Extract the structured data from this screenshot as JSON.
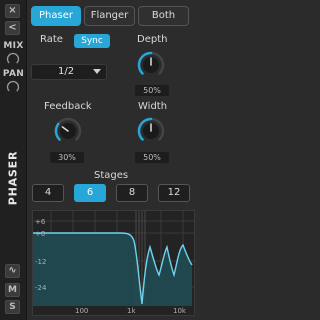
{
  "sidebar": {
    "close_glyph": "×",
    "collapse_glyph": "<",
    "mix_label": "MIX",
    "pan_label": "PAN",
    "title": "PHASER",
    "wave_glyph": "∿",
    "m_label": "M",
    "s_label": "S"
  },
  "tabs": [
    {
      "label": "Phaser",
      "active": true
    },
    {
      "label": "Flanger",
      "active": false
    },
    {
      "label": "Both",
      "active": false
    }
  ],
  "rate": {
    "label": "Rate",
    "sync_label": "Sync",
    "value": "1/2"
  },
  "depth": {
    "label": "Depth",
    "value": "50%",
    "level": 0.5
  },
  "feedback": {
    "label": "Feedback",
    "value": "30%",
    "level": 0.3
  },
  "width": {
    "label": "Width",
    "value": "50%",
    "level": 0.5
  },
  "stages": {
    "label": "Stages",
    "options": [
      "4",
      "6",
      "8",
      "12"
    ],
    "selected": "6"
  },
  "graph": {
    "y_ticks": [
      "+6",
      "+0",
      "-12",
      "-24"
    ],
    "x_ticks": [
      "100",
      "1k",
      "10k"
    ]
  },
  "colors": {
    "accent": "#27a6d8",
    "curve": "#6fd3f0"
  }
}
